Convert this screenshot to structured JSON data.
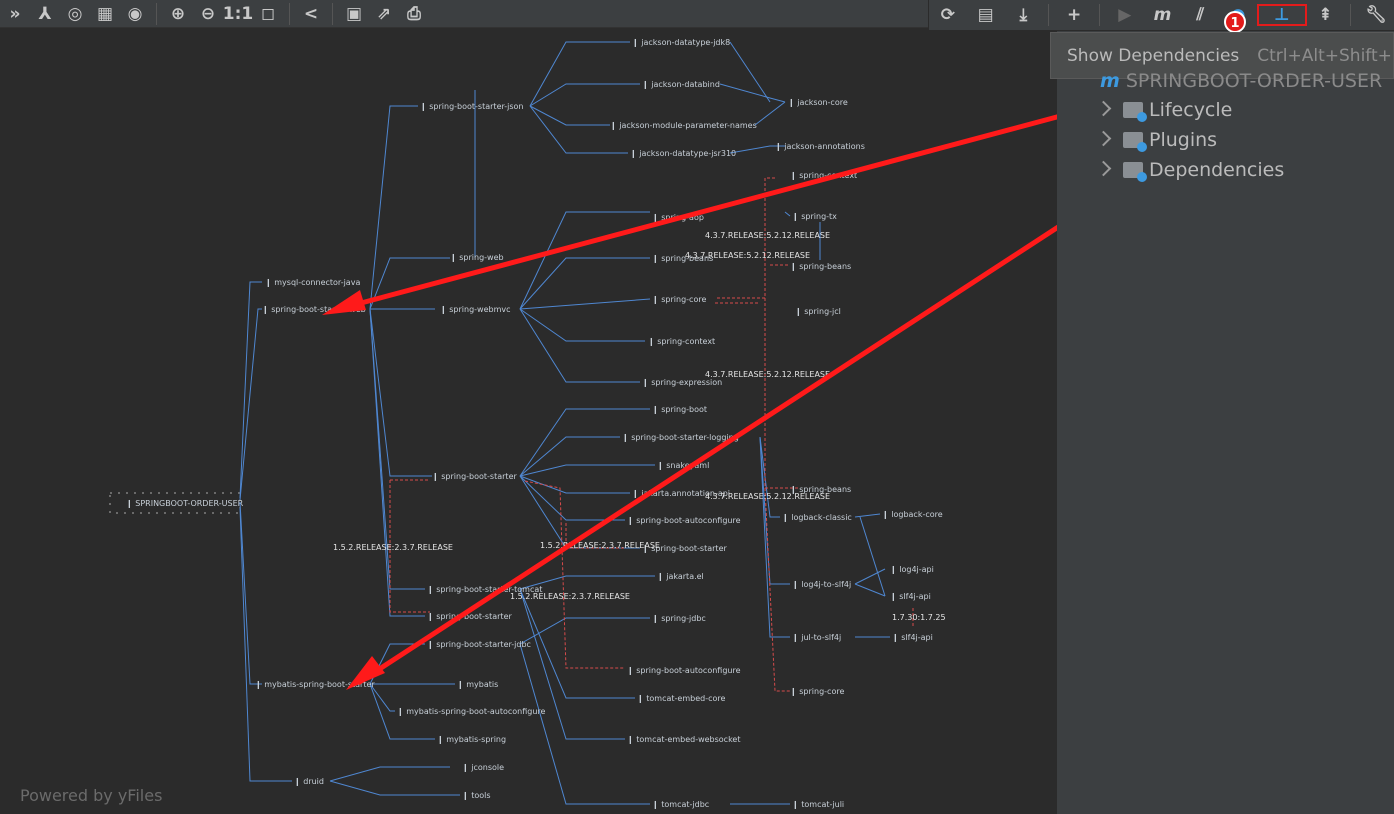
{
  "left_toolbar": {
    "icons": [
      "expand-icon",
      "fork-icon",
      "focus-icon",
      "grid-icon",
      "eye-icon",
      "zoom-in-icon",
      "zoom-out-icon",
      "actual-size-icon",
      "fit-icon",
      "share-icon",
      "save-icon",
      "export-icon",
      "print-icon"
    ],
    "actual_size_label": "1:1"
  },
  "right_toolbar": {
    "icons": [
      "refresh-icon",
      "reimport-icon",
      "download-icon",
      "add-icon",
      "run-icon",
      "maven-icon",
      "toggle-offline-icon",
      "lifecycle-icon",
      "show-dependencies-icon",
      "collapse-icon",
      "settings-icon"
    ],
    "maven_label": "m",
    "badge": "1"
  },
  "tooltip": {
    "label": "Show Dependencies",
    "shortcut": "Ctrl+Alt+Shift+"
  },
  "maven_tree": {
    "project": "SPRINGBOOT-ORDER-USER",
    "items": [
      "Lifecycle",
      "Plugins",
      "Dependencies"
    ]
  },
  "graph": {
    "root": "SPRINGBOOT-ORDER-USER",
    "nodes": [
      "mysql-connector-java",
      "spring-boot-starter-web",
      "spring-boot-starter-json",
      "spring-web",
      "spring-webmvc",
      "jackson-datatype-jdk8",
      "jackson-databind",
      "jackson-module-parameter-names",
      "jackson-datatype-jsr310",
      "jackson-core",
      "jackson-annotations",
      "spring-aop",
      "spring-beans",
      "spring-core",
      "spring-context",
      "spring-expression",
      "spring-boot",
      "spring-boot-starter",
      "spring-boot-starter-logging",
      "snakeyaml",
      "jakarta.annotation-api",
      "spring-boot-autoconfigure",
      "spring-boot-starter",
      "jakarta.el",
      "spring-boot-starter-tomcat",
      "spring-boot-starter",
      "spring-boot-starter-jdbc",
      "spring-jdbc",
      "spring-boot-autoconfigure",
      "mybatis-spring-boot-starter",
      "mybatis",
      "mybatis-spring-boot-autoconfigure",
      "mybatis-spring",
      "tomcat-embed-core",
      "tomcat-embed-websocket",
      "druid",
      "jconsole",
      "tools",
      "tomcat-jdbc",
      "tomcat-juli",
      "spring-jcl",
      "spring-tx",
      "spring-beans",
      "logback-classic",
      "logback-core",
      "log4j-to-slf4j",
      "log4j-api",
      "slf4j-api",
      "jul-to-slf4j",
      "slf4j-api",
      "spring-beans",
      "spring-core",
      "spring-context"
    ],
    "version_labels": [
      "4.3.7.RELEASE:5.2.12.RELEASE",
      "4.3.7.RELEASE:5.2.12.RELEASE",
      "4.3.7.RELEASE:5.2.12.RELEASE",
      "4.3.7.RELEASE:5.2.12.RELEASE",
      "1.5.2.RELEASE:2.3.7.RELEASE",
      "1.5.2.RELEASE:2.3.7.RELEASE",
      "1.5.2.RELEASE:2.3.7.RELEASE",
      "1.7.30:1.7.25"
    ]
  },
  "powered_by": "Powered by yFiles"
}
